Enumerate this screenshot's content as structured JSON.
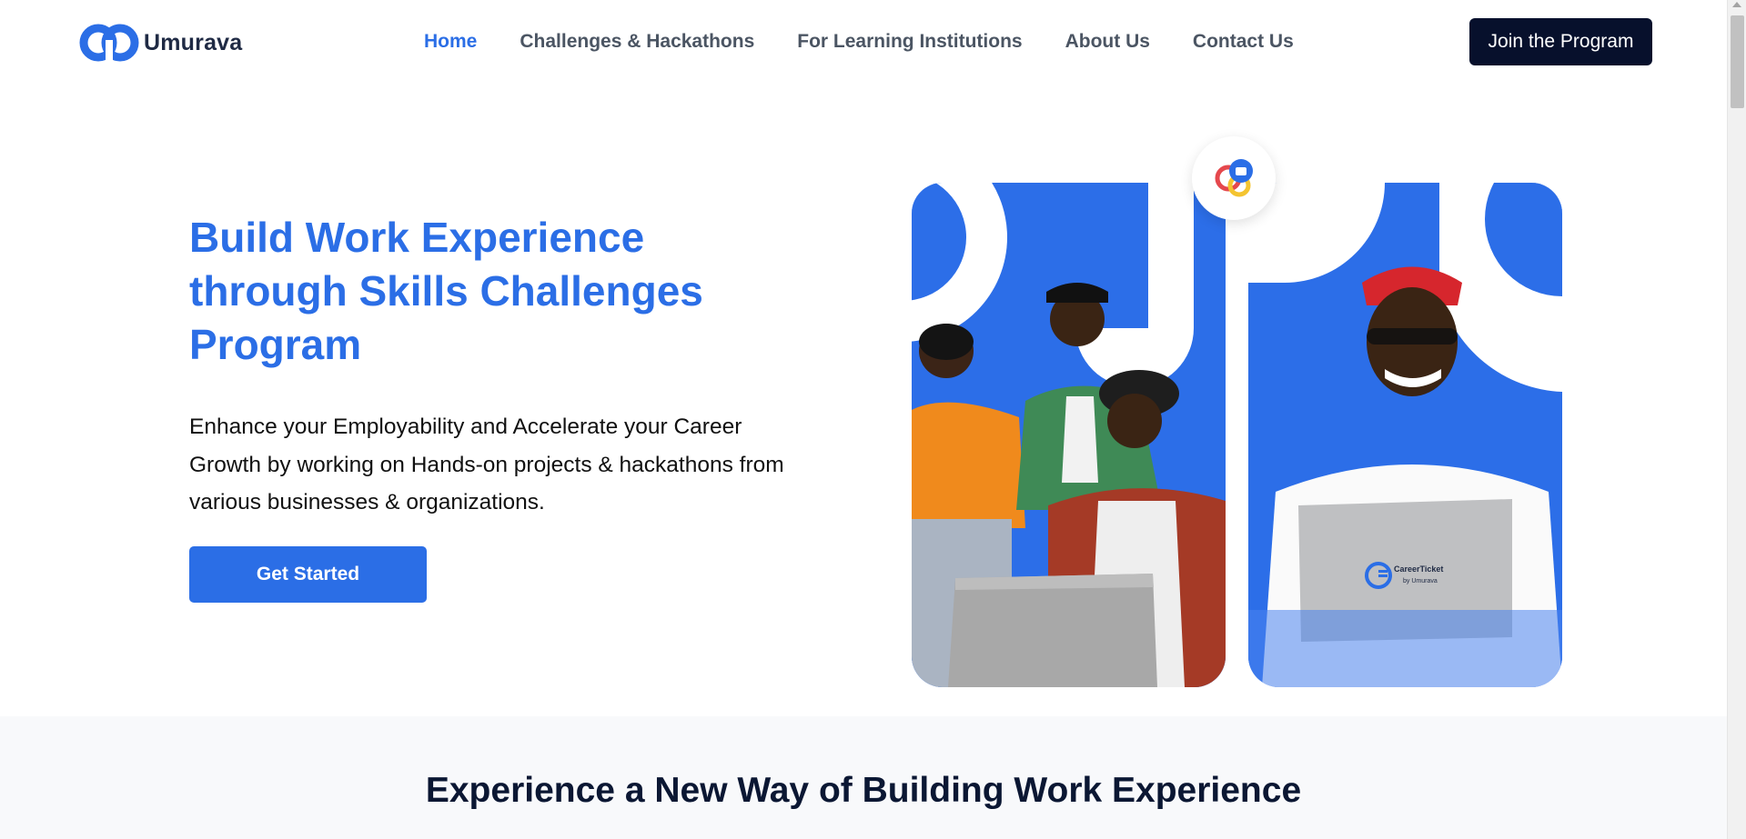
{
  "brand": {
    "name": "Umurava"
  },
  "nav": {
    "items": [
      {
        "label": "Home",
        "active": true
      },
      {
        "label": "Challenges & Hackathons",
        "active": false
      },
      {
        "label": "For Learning Institutions",
        "active": false
      },
      {
        "label": "About Us",
        "active": false
      },
      {
        "label": "Contact Us",
        "active": false
      }
    ]
  },
  "header": {
    "cta_label": "Join the Program"
  },
  "hero": {
    "title": "Build Work Experience through Skills Challenges Program",
    "subtitle": "Enhance your Employability and Accelerate your Career Growth by working on Hands-on projects & hackathons from various businesses & organizations.",
    "cta_label": "Get Started",
    "laptop_brand": "CareerTicket",
    "laptop_sub": "by Umurava"
  },
  "section": {
    "title": "Experience a New Way of Building Work Experience"
  },
  "colors": {
    "accent": "#2b6ee6",
    "dark": "#07102c",
    "section_bg": "#f8f9fb"
  },
  "icons": [
    "umurava-logo-icon",
    "chat-bubbles-icon"
  ]
}
